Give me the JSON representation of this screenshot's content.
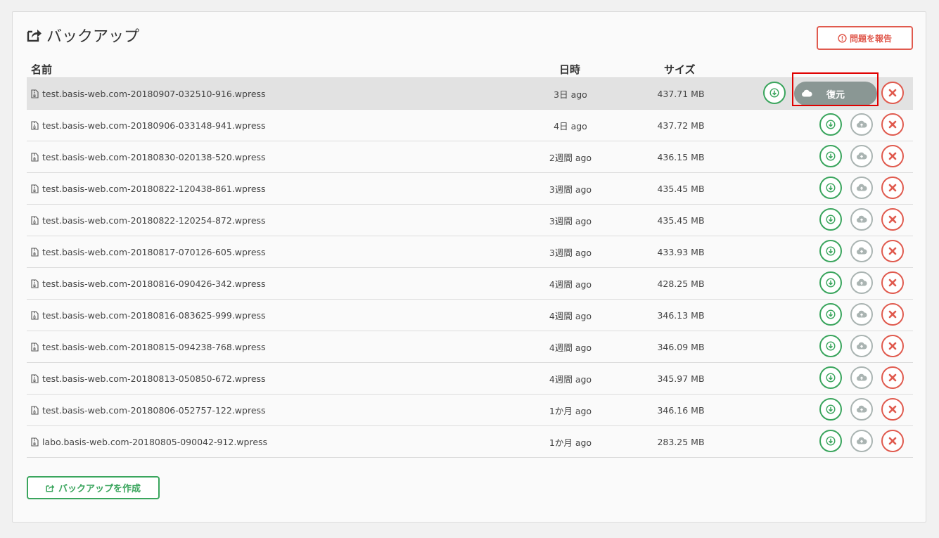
{
  "header": {
    "title": "バックアップ",
    "title_icon": "share-square-icon",
    "report_label": "問題を報告",
    "report_icon": "exclamation-circle-icon"
  },
  "table": {
    "columns": {
      "name": "名前",
      "date": "日時",
      "size": "サイズ"
    },
    "restore_label": "復元",
    "rows": [
      {
        "name": "test.basis-web.com-20180907-032510-916.wpress",
        "date": "3日 ago",
        "size": "437.71 MB"
      },
      {
        "name": "test.basis-web.com-20180906-033148-941.wpress",
        "date": "4日 ago",
        "size": "437.72 MB"
      },
      {
        "name": "test.basis-web.com-20180830-020138-520.wpress",
        "date": "2週間 ago",
        "size": "436.15 MB"
      },
      {
        "name": "test.basis-web.com-20180822-120438-861.wpress",
        "date": "3週間 ago",
        "size": "435.45 MB"
      },
      {
        "name": "test.basis-web.com-20180822-120254-872.wpress",
        "date": "3週間 ago",
        "size": "435.45 MB"
      },
      {
        "name": "test.basis-web.com-20180817-070126-605.wpress",
        "date": "3週間 ago",
        "size": "433.93 MB"
      },
      {
        "name": "test.basis-web.com-20180816-090426-342.wpress",
        "date": "4週間 ago",
        "size": "428.25 MB"
      },
      {
        "name": "test.basis-web.com-20180816-083625-999.wpress",
        "date": "4週間 ago",
        "size": "346.13 MB"
      },
      {
        "name": "test.basis-web.com-20180815-094238-768.wpress",
        "date": "4週間 ago",
        "size": "346.09 MB"
      },
      {
        "name": "test.basis-web.com-20180813-050850-672.wpress",
        "date": "4週間 ago",
        "size": "345.97 MB"
      },
      {
        "name": "test.basis-web.com-20180806-052757-122.wpress",
        "date": "1か月 ago",
        "size": "346.16 MB"
      },
      {
        "name": "labo.basis-web.com-20180805-090042-912.wpress",
        "date": "1か月 ago",
        "size": "283.25 MB"
      }
    ]
  },
  "footer": {
    "create_label": "バックアップを作成",
    "create_icon": "share-square-icon"
  },
  "colors": {
    "accent_green": "#3aa55d",
    "danger_red": "#e05a4e",
    "restore_gray": "#8a9794",
    "highlight_red": "#e00000"
  }
}
